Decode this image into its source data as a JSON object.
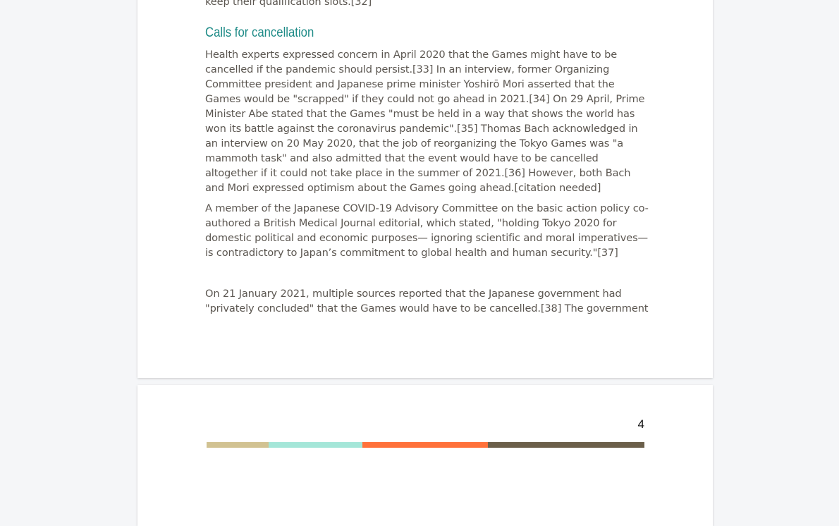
{
  "page1": {
    "prev_tail": "keep their qualification slots.[32]",
    "heading": "Calls for cancellation",
    "paragraphs": [
      "Health experts expressed concern in April 2020 that the Games might have to be cancelled if the pandemic should persist.[33] In an interview, former Organizing Committee president and Japanese prime minister Yoshirō Mori asserted that the Games would be \"scrapped\" if they could not go ahead in 2021.[34] On 29 April, Prime Minister Abe stated that the Games \"must be held in a way that shows the world has won its battle against the coronavirus pandemic\".[35] Thomas Bach acknowledged in an interview on 20 May 2020, that the job of reorganizing the Tokyo Games was \"a mammoth task\" and also admitted that the event would have to be cancelled altogether if it could not take place in the summer of 2021.[36] However, both Bach and Mori expressed optimism about the Games going ahead.[citation needed]",
      "A member of the Japanese COVID-19 Advisory Committee on the basic action policy co-authored a British Medical Journal editorial, which stated, \"holding Tokyo 2020 for domestic political and economic purposes— ignoring scientific and moral imperatives—is contradictory to Japan’s commitment to global health and human security.\"[37]",
      "On 21 January 2021, multiple sources reported that the Japanese government had \"privately concluded\" that the Games would have to be cancelled.[38] The government"
    ]
  },
  "page2": {
    "page_number": "4",
    "bar_colors": [
      "#d1c292",
      "#a4e6d8",
      "#ff713a",
      "#6b5f4a"
    ]
  }
}
